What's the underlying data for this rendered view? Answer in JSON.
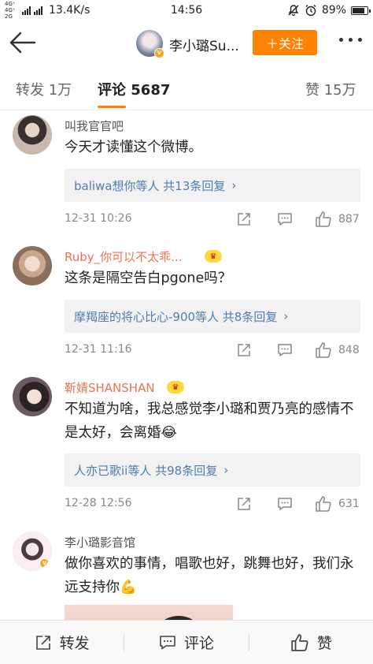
{
  "status_bar": {
    "network": "4G⁺ 4G⁺ 2G",
    "speed": "13.4K/s",
    "time": "14:56",
    "battery": "89%",
    "battery_level": 0.89
  },
  "nav": {
    "title": "李小璐Su...",
    "follow_label": "＋关注",
    "accent": "#ff8200"
  },
  "tabs": [
    {
      "label": "转发 1万"
    },
    {
      "label": "评论 5687"
    },
    {
      "label": "赞 15万"
    }
  ],
  "comments": [
    {
      "name": "叫我官官吧",
      "text": "今天才读懂这个微博。",
      "reply_summary": "baliwa想你等人 共13条回复",
      "time": "12-31 10:26",
      "likes": "887"
    },
    {
      "name": "Ruby_你可以不太乖...",
      "text": "这条是隔空告白pgone吗？",
      "reply_summary": "摩羯座的将心比心-900等人 共8条回复",
      "time": "12-31 11:16",
      "likes": "848"
    },
    {
      "name": "靳婧SHANSHAN",
      "text": "不知道为啥，我总感觉李小璐和贾乃亮的感情不是太好，会离婚😂",
      "reply_summary": "人亦已歌ii等人 共98条回复",
      "time": "12-28 12:56",
      "likes": "631"
    },
    {
      "name": "李小璐影音馆",
      "text": "做你喜欢的事情，唱歌也好，跳舞也好，我们永远支持你💪"
    }
  ],
  "bottom_bar": {
    "repost_label": "转发",
    "comment_label": "评论",
    "like_label": "赞"
  },
  "colors": {
    "link": "#507daf",
    "name_highlight": "#eb7350",
    "vip_badge": "#ffd93a"
  }
}
